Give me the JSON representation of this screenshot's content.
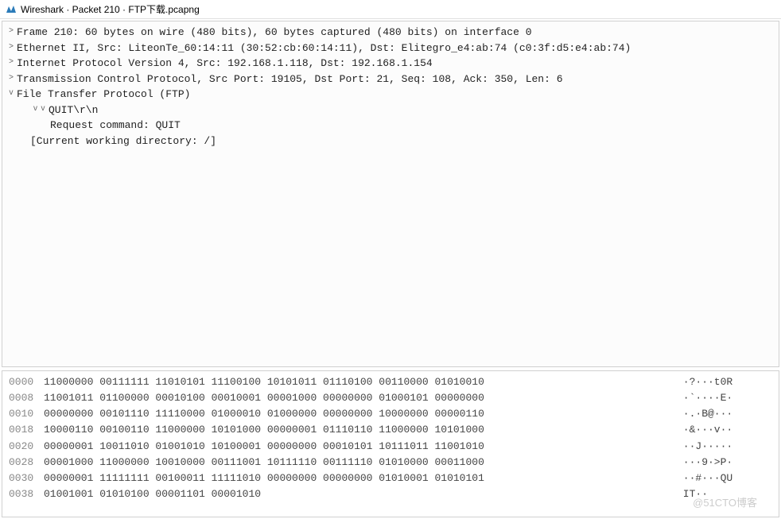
{
  "window": {
    "title": "Wireshark · Packet 210 · FTP下载.pcapng"
  },
  "packet_tree": [
    {
      "toggle": ">",
      "indent": 0,
      "text": "Frame 210: 60 bytes on wire (480 bits), 60 bytes captured (480 bits) on interface 0"
    },
    {
      "toggle": ">",
      "indent": 0,
      "text": "Ethernet II, Src: LiteonTe_60:14:11 (30:52:cb:60:14:11), Dst: Elitegro_e4:ab:74 (c0:3f:d5:e4:ab:74)"
    },
    {
      "toggle": ">",
      "indent": 0,
      "text": "Internet Protocol Version 4, Src: 192.168.1.118, Dst: 192.168.1.154"
    },
    {
      "toggle": ">",
      "indent": 0,
      "text": "Transmission Control Protocol, Src Port: 19105, Dst Port: 21, Seq: 108, Ack: 350, Len: 6"
    },
    {
      "toggle": "v",
      "indent": 0,
      "text": "File Transfer Protocol (FTP)"
    },
    {
      "toggle": "v",
      "indent": 1,
      "text": "QUIT\\r\\n"
    },
    {
      "toggle": "",
      "indent": 2,
      "text": "Request command: QUIT"
    },
    {
      "toggle": "",
      "indent": 1,
      "text": "[Current working directory: /]"
    }
  ],
  "hex_dump": [
    {
      "offset": "0000",
      "bytes": "11000000 00111111 11010101 11100100 10101011 01110100 00110000 01010010",
      "ascii": " ·?···t0R"
    },
    {
      "offset": "0008",
      "bytes": "11001011 01100000 00010100 00010001 00001000 00000000 01000101 00000000",
      "ascii": " ·`····E·"
    },
    {
      "offset": "0010",
      "bytes": "00000000 00101110 11110000 01000010 01000000 00000000 10000000 00000110",
      "ascii": " ·.·B@···"
    },
    {
      "offset": "0018",
      "bytes": "10000110 00100110 11000000 10101000 00000001 01110110 11000000 10101000",
      "ascii": " ·&···v··"
    },
    {
      "offset": "0020",
      "bytes": "00000001 10011010 01001010 10100001 00000000 00010101 10111011 11001010",
      "ascii": " ··J·····"
    },
    {
      "offset": "0028",
      "bytes": "00001000 11000000 10010000 00111001 10111110 00111110 01010000 00011000",
      "ascii": " ···9·>P·"
    },
    {
      "offset": "0030",
      "bytes": "00000001 11111111 00100011 11111010 00000000 00000000 01010001 01010101",
      "ascii": " ··#···QU"
    },
    {
      "offset": "0038",
      "bytes": "01001001 01010100 00001101 00001010",
      "ascii": " IT··"
    }
  ],
  "watermark": "@51CTO博客"
}
